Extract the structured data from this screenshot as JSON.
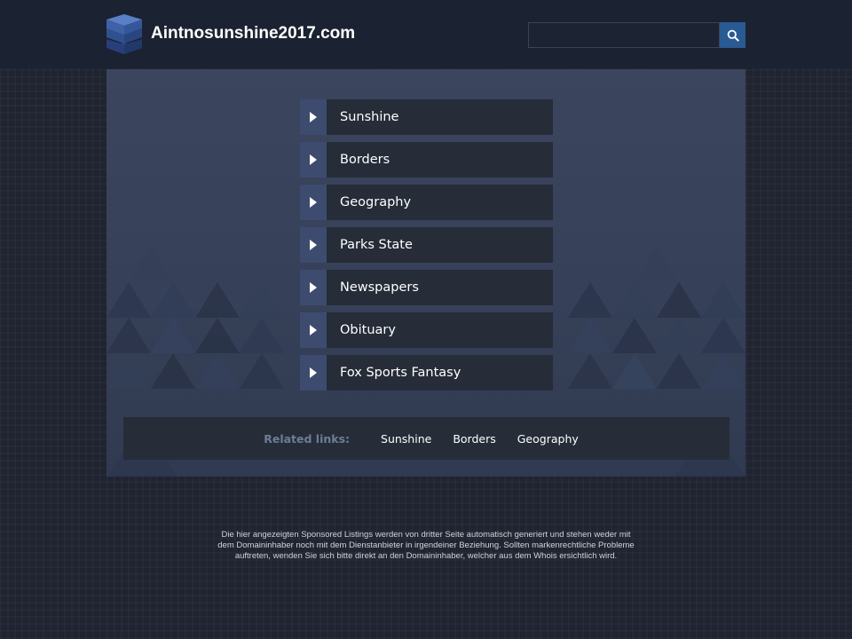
{
  "header": {
    "site_title": "Aintnosunshine2017.com",
    "search": {
      "value": "",
      "placeholder": ""
    }
  },
  "menu": {
    "items": [
      {
        "label": "Sunshine"
      },
      {
        "label": "Borders"
      },
      {
        "label": "Geography"
      },
      {
        "label": "Parks State"
      },
      {
        "label": "Newspapers"
      },
      {
        "label": "Obituary"
      },
      {
        "label": "Fox Sports Fantasy"
      }
    ]
  },
  "related": {
    "title": "Related links:",
    "links": [
      "Sunshine",
      "Borders",
      "Geography"
    ]
  },
  "disclaimer": "Die hier angezeigten Sponsored Listings werden von dritter Seite automatisch generiert und stehen weder mit dem Domaininhaber noch mit dem Dienstanbieter in irgendeiner Beziehung. Sollten markenrechtliche Probleme auftreten, wenden Sie sich bitte direkt an den Domaininhaber, welcher aus dem Whois ersichtlich wird.",
  "colors": {
    "accent": "#2a5a93",
    "header_bg": "#1b2231",
    "menu_arrow_bg": "#3d4b6e",
    "menu_label_bg": "#262c38"
  },
  "icons": {
    "logo": "stacked-layers-icon",
    "search": "search-icon",
    "menu_arrow": "play-arrow-icon"
  }
}
